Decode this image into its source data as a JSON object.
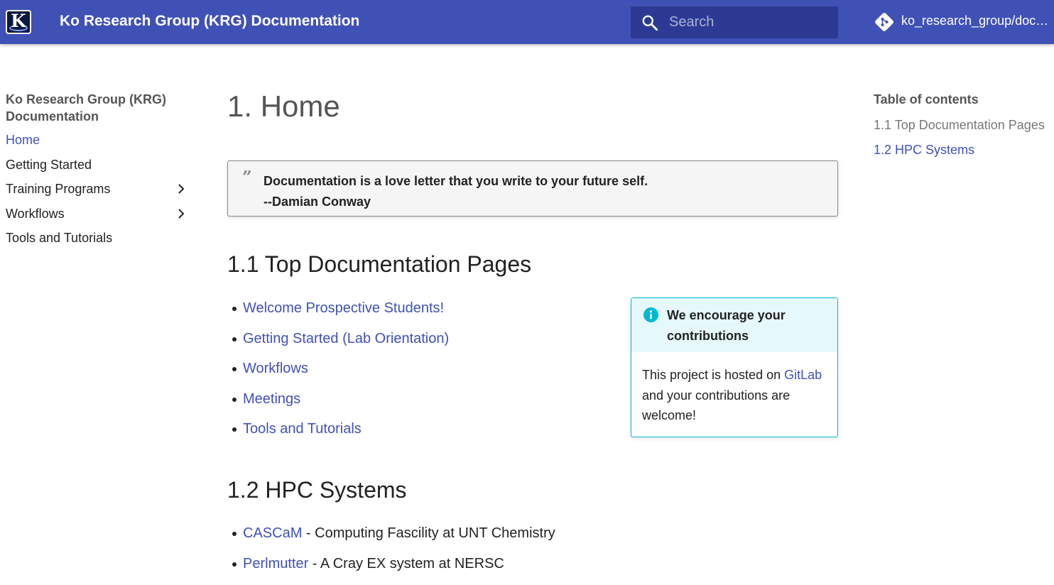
{
  "header": {
    "logo_letter": "K",
    "site_title": "Ko Research Group (KRG) Documentation",
    "search": {
      "placeholder": "Search",
      "value": ""
    },
    "repo_name": "ko_research_group/documentation",
    "colors": {
      "primary": "#4051b5",
      "search_bg": "#2c3a93"
    },
    "icons": {
      "logo": "krg-logo-icon",
      "search": "search-icon",
      "repo": "git-icon"
    }
  },
  "nav": {
    "title": "Ko Research Group (KRG) Documentation",
    "items": [
      {
        "label": "Home",
        "active": true,
        "expandable": false
      },
      {
        "label": "Getting Started",
        "active": false,
        "expandable": false
      },
      {
        "label": "Training Programs",
        "active": false,
        "expandable": true
      },
      {
        "label": "Workflows",
        "active": false,
        "expandable": true
      },
      {
        "label": "Tools and Tutorials",
        "active": false,
        "expandable": false
      }
    ]
  },
  "main": {
    "title": "1. Home",
    "quote": {
      "text": "Documentation is a love letter that you write to your future self.",
      "attribution": "--Damian Conway"
    },
    "section1": {
      "heading": "1.1 Top Documentation Pages",
      "links": [
        "Welcome Prospective Students!",
        "Getting Started (Lab Orientation)",
        "Workflows",
        "Meetings",
        "Tools and Tutorials"
      ]
    },
    "admonition": {
      "type": "info",
      "title": "We encourage your contributions",
      "body_before": "This project is hosted on ",
      "body_link": "GitLab",
      "body_after": " and your contributions are welcome!",
      "accent_color": "#00b8d4"
    },
    "section2": {
      "heading": "1.2 HPC Systems",
      "items": [
        {
          "link": "CASCaM",
          "desc": " - Computing Fascility at UNT Chemistry"
        },
        {
          "link": "Perlmutter",
          "desc": " - A Cray EX system at NERSC"
        }
      ]
    }
  },
  "toc": {
    "title": "Table of contents",
    "items": [
      {
        "label": "1.1 Top Documentation Pages",
        "active": false
      },
      {
        "label": "1.2 HPC Systems",
        "active": true
      }
    ]
  }
}
